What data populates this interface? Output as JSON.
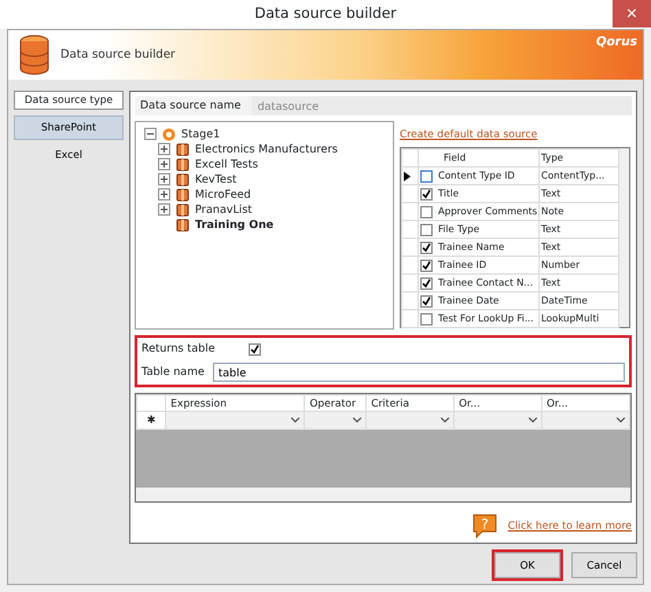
{
  "window": {
    "title": "Data source builder",
    "close": "×"
  },
  "header": {
    "title": "Data source builder",
    "logo": "Qorus"
  },
  "source_types": {
    "heading": "Data source type",
    "items": [
      {
        "label": "SharePoint",
        "selected": true
      },
      {
        "label": "Excel",
        "selected": false
      }
    ]
  },
  "name_field": {
    "label": "Data source name",
    "value": "datasource"
  },
  "tree": {
    "label": "Stage1",
    "expanded": true,
    "children": [
      {
        "label": "Electronics Manufacturers",
        "has_children": true,
        "selected": false
      },
      {
        "label": "Excell Tests",
        "has_children": true,
        "selected": false
      },
      {
        "label": "KevTest",
        "has_children": true,
        "selected": false
      },
      {
        "label": "MicroFeed",
        "has_children": true,
        "selected": false
      },
      {
        "label": "PranavList",
        "has_children": true,
        "selected": false
      },
      {
        "label": "Training One",
        "has_children": false,
        "selected": true
      }
    ]
  },
  "create_link": "Create default data source",
  "fields_table": {
    "columns": [
      "Field",
      "Type"
    ],
    "rows": [
      {
        "field": "Content Type ID",
        "type": "ContentTyp...",
        "checked": false,
        "selected": true
      },
      {
        "field": "Title",
        "type": "Text",
        "checked": true,
        "selected": false
      },
      {
        "field": "Approver Comments",
        "type": "Note",
        "checked": false,
        "selected": false
      },
      {
        "field": "File Type",
        "type": "Text",
        "checked": false,
        "selected": false
      },
      {
        "field": "Trainee Name",
        "type": "Text",
        "checked": true,
        "selected": false
      },
      {
        "field": "Trainee ID",
        "type": "Number",
        "checked": true,
        "selected": false
      },
      {
        "field": "Trainee Contact N...",
        "type": "Text",
        "checked": true,
        "selected": false
      },
      {
        "field": "Trainee Date",
        "type": "DateTime",
        "checked": true,
        "selected": false
      },
      {
        "field": "Test For LookUp Fi...",
        "type": "LookupMulti",
        "checked": false,
        "selected": false
      }
    ]
  },
  "options": {
    "highlighted": true,
    "returns_table": {
      "label": "Returns table",
      "checked": true
    },
    "table_name": {
      "label": "Table name",
      "value": "table"
    }
  },
  "criteria_grid": {
    "columns": [
      "Expression",
      "Operator",
      "Criteria",
      "Or...",
      "Or..."
    ],
    "new_row_marker": "✱"
  },
  "help_icon": "?",
  "help_link": "Click here to learn more",
  "buttons": [
    {
      "label": "OK",
      "highlighted": true
    },
    {
      "label": "Cancel",
      "highlighted": false
    }
  ]
}
